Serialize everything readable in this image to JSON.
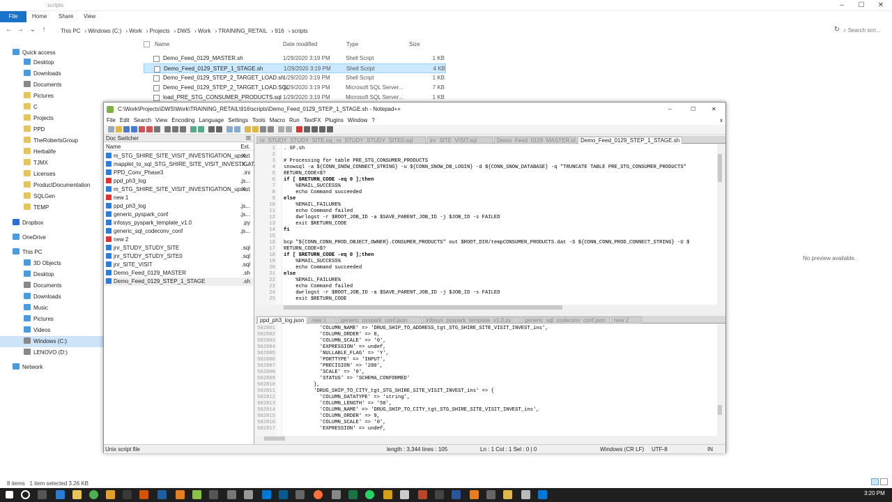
{
  "explorer": {
    "title": "scripts",
    "ribbon": {
      "file": "File",
      "home": "Home",
      "share": "Share",
      "view": "View"
    },
    "path": [
      "This PC",
      "Windows (C:)",
      "Work",
      "Projects",
      "DWS",
      "Work",
      "TRAINING_RETAIL",
      "916",
      "scripts"
    ],
    "search_placeholder": "Search scri...",
    "columns": {
      "name": "Name",
      "date": "Date modified",
      "type": "Type",
      "size": "Size"
    },
    "files": [
      {
        "name": "Demo_Feed_0129_MASTER.sh",
        "date": "1/29/2020 3:19 PM",
        "type": "Shell Script",
        "size": "1 KB"
      },
      {
        "name": "Demo_Feed_0129_STEP_1_STAGE.sh",
        "date": "1/29/2020 3:19 PM",
        "type": "Shell Script",
        "size": "4 KB"
      },
      {
        "name": "Demo_Feed_0129_STEP_2_TARGET_LOAD.sh",
        "date": "1/29/2020 3:19 PM",
        "type": "Shell Script",
        "size": "1 KB"
      },
      {
        "name": "Demo_Feed_0129_STEP_2_TARGET_LOAD.SQL",
        "date": "1/29/2020 3:19 PM",
        "type": "Microsoft SQL Server...",
        "size": "7 KB"
      },
      {
        "name": "load_PRE_STG_CONSUMER_PRODUCTS.sql",
        "date": "1/29/2020 3:19 PM",
        "type": "Microsoft SQL Server...",
        "size": "1 KB"
      }
    ],
    "nav": [
      "Quick access",
      "Desktop",
      "Downloads",
      "Documents",
      "Pictures",
      "C",
      "Projects",
      "PPD",
      "TheRobertsGroup",
      "Herbalife",
      "TJMX",
      "Licenses",
      "ProductDocumentation",
      "SQLGen",
      "TEMP",
      "Dropbox",
      "OneDrive",
      "This PC",
      "3D Objects",
      "Desktop",
      "Documents",
      "Downloads",
      "Music",
      "Pictures",
      "Videos",
      "Windows (C:)",
      "LENOVO (D:)",
      "Network"
    ],
    "no_preview": "No preview available.",
    "status_items": "8 items",
    "status_selected": "1 item selected  3.26 KB"
  },
  "npp": {
    "title": "C:\\Work\\Projects\\DWS\\Work\\TRAINING_RETAIL\\916\\scripts\\Demo_Feed_0129_STEP_1_STAGE.sh - Notepad++",
    "menu": [
      "File",
      "Edit",
      "Search",
      "View",
      "Encoding",
      "Language",
      "Settings",
      "Tools",
      "Macro",
      "Run",
      "TextFX",
      "Plugins",
      "Window",
      "?"
    ],
    "doc_switcher": "Doc Switcher",
    "doc_cols": {
      "name": "Name",
      "ext": "Ext."
    },
    "docs": [
      {
        "name": "m_STG_SHIRE_SITE_VISIT_INVESTIGATION_upsert",
        "ext": ".X..."
      },
      {
        "name": "mapplet_to_sql_STG_SHIRE_SITE_VISIT_INVESTIGAT...",
        "ext": ".X..."
      },
      {
        "name": "PPD_Conv_Phase3",
        "ext": ".ini"
      },
      {
        "name": "ppd_ph3_log",
        "ext": ".js..."
      },
      {
        "name": "m_STG_SHIRE_SITE_VISIT_INVESTIGATION_upsert",
        "ext": ".X..."
      },
      {
        "name": "new 1",
        "ext": ""
      },
      {
        "name": "ppd_ph3_log",
        "ext": ".js..."
      },
      {
        "name": "generic_pyspark_conf",
        "ext": ".js..."
      },
      {
        "name": "infosys_pyspark_template_v1.0",
        "ext": ".py"
      },
      {
        "name": "generic_sql_codeconv_conf",
        "ext": ".js..."
      },
      {
        "name": "new 2",
        "ext": ""
      },
      {
        "name": "jnr_STUDY_STUDY_SITE",
        "ext": ".sql"
      },
      {
        "name": "jnr_STUDY_STUDY_SITE0",
        "ext": ".sql"
      },
      {
        "name": "jnr_SITE_VISIT",
        "ext": ".sql"
      },
      {
        "name": "Demo_Feed_0129_MASTER",
        "ext": ".sh"
      },
      {
        "name": "Demo_Feed_0129_STEP_1_STAGE",
        "ext": ".sh"
      }
    ],
    "top_tabs": [
      "nr_STUDY_STUDY_SITE.sql",
      "nr_STUDY_STUDY_SITE0.sql",
      "jnr_SITE_VISIT.sql",
      "Demo_Feed_0129_MASTER.sh",
      "Demo_Feed_0129_STEP_1_STAGE.sh"
    ],
    "bottom_tabs": [
      "ppd_ph3_log.json",
      "new 1",
      "generic_pyspark_conf.json",
      "infosys_pyspark_template_v1.0.py",
      "generic_sql_codeconv_conf.json",
      "new 2"
    ],
    "top_lines": [
      {
        "n": "1",
        "t": ". SF.sh"
      },
      {
        "n": "2",
        "t": ""
      },
      {
        "n": "3",
        "t": "# Processing for table PRE_STG_CONSUMER_PRODUCTS"
      },
      {
        "n": "4",
        "t": "snowsql -a ${CONN_SNOW_CONNECT_STRING} -u ${CONN_SNOW_DB_LOGIN} -d ${CONN_SNOW_DATABASE} -q \"TRUNCATE TABLE PRE_STG_CONSUMER_PRODUCTS\""
      },
      {
        "n": "5",
        "t": "RETURN_CODE=$?"
      },
      {
        "n": "6",
        "t": "if [ $RETURN_CODE -eq 0 ];then"
      },
      {
        "n": "7",
        "t": "    %EMAIL_SUCCESS%"
      },
      {
        "n": "8",
        "t": "    echo Command succeeded"
      },
      {
        "n": "9",
        "t": "else"
      },
      {
        "n": "10",
        "t": "    %EMAIL_FAILURE%"
      },
      {
        "n": "11",
        "t": "    echo Command failed"
      },
      {
        "n": "12",
        "t": "    dwrlogst -r $ROOT_JOB_ID -a $SAVE_PARENT_JOB_ID -j $JOB_ID -s FAILED"
      },
      {
        "n": "13",
        "t": "    exit $RETURN_CODE"
      },
      {
        "n": "14",
        "t": "fi"
      },
      {
        "n": "15",
        "t": ""
      },
      {
        "n": "16",
        "t": "bcp \"${CONN_CONN_PROD_OBJECT_OWNER}.CONSUMER_PRODUCTS\" out $ROOT_DIR/tempCONSUMER_PRODUCTS.dat -S ${CONN_CONN_PROD_CONNECT_STRING} -U $"
      },
      {
        "n": "17",
        "t": "RETURN_CODE=$?"
      },
      {
        "n": "18",
        "t": "if [ $RETURN_CODE -eq 0 ];then"
      },
      {
        "n": "19",
        "t": "    %EMAIL_SUCCESS%"
      },
      {
        "n": "20",
        "t": "    echo Command succeeded"
      },
      {
        "n": "21",
        "t": "else"
      },
      {
        "n": "22",
        "t": "    %EMAIL_FAILURE%"
      },
      {
        "n": "23",
        "t": "    echo Command failed"
      },
      {
        "n": "24",
        "t": "    dwrlogst -r $ROOT_JOB_ID -a $SAVE_PARENT_JOB_ID -j $JOB_ID -s FAILED"
      },
      {
        "n": "25",
        "t": "    exit $RETURN_CODE"
      }
    ],
    "bottom_lines": [
      {
        "n": "502801",
        "t": "            'COLUMN_NAME' => 'DRUG_SHIP_TO_ADDRESS_tgt_STG_SHIRE_SITE_VISIT_INVEST_ins',"
      },
      {
        "n": "502802",
        "t": "            'COLUMN_ORDER' => 8,"
      },
      {
        "n": "502803",
        "t": "            'COLUMN_SCALE' => '0',"
      },
      {
        "n": "502804",
        "t": "            'EXPRESSION' => undef,"
      },
      {
        "n": "502805",
        "t": "            'NULLABLE_FLAG' => 'Y',"
      },
      {
        "n": "502806",
        "t": "            'PORTTYPE' => 'INPUT',"
      },
      {
        "n": "502807",
        "t": "            'PRECISION' => '200',"
      },
      {
        "n": "502808",
        "t": "            'SCALE' => '0',"
      },
      {
        "n": "502809",
        "t": "            'STATUS' => 'SCHEMA_CONFORMED'"
      },
      {
        "n": "502810",
        "t": "          },"
      },
      {
        "n": "502811",
        "t": "          'DRUG_SHIP_TO_CITY_tgt_STG_SHIRE_SITE_VISIT_INVEST_ins' => {"
      },
      {
        "n": "502812",
        "t": "            'COLUMN_DATATYPE' => 'string',"
      },
      {
        "n": "502813",
        "t": "            'COLUMN_LENGTH' => '50',"
      },
      {
        "n": "502814",
        "t": "            'COLUMN_NAME' => 'DRUG_SHIP_TO_CITY_tgt_STG_SHIRE_SITE_VISIT_INVEST_ins',"
      },
      {
        "n": "502815",
        "t": "            'COLUMN_ORDER' => 9,"
      },
      {
        "n": "502816",
        "t": "            'COLUMN_SCALE' => '0',"
      },
      {
        "n": "502817",
        "t": "            'EXPRESSION' => undef,"
      }
    ],
    "status": {
      "type": "Unix script file",
      "length": "length : 3,344    lines : 105",
      "pos": "Ln : 1    Col : 1    Sel : 0 | 0",
      "eol": "Windows (CR LF)",
      "enc": "UTF-8",
      "ins": "IN"
    }
  },
  "taskbar": {
    "time": "3:20 PM"
  }
}
